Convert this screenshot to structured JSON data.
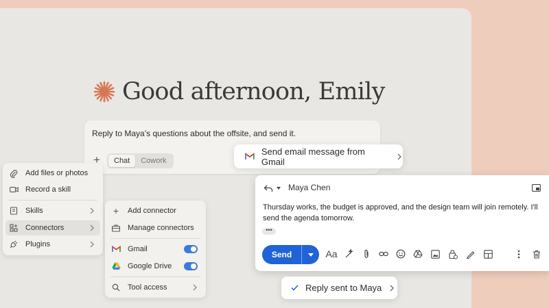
{
  "greeting": {
    "text": "Good afternoon, Emily"
  },
  "composer": {
    "prompt": "Reply to Maya’s questions about the offsite, and send it.",
    "modes": [
      "Chat",
      "Cowork"
    ],
    "active_mode": "Chat"
  },
  "attach_menu": {
    "items": [
      {
        "label": "Add files or photos",
        "icon": "paperclip-icon"
      },
      {
        "label": "Record a skill",
        "icon": "video-icon"
      },
      {
        "label": "Skills",
        "icon": "book-icon"
      },
      {
        "label": "Connectors",
        "icon": "connectors-icon",
        "selected": true
      },
      {
        "label": "Plugins",
        "icon": "plug-icon"
      }
    ]
  },
  "connectors_menu": {
    "add": "Add connector",
    "manage": "Manage connectors",
    "connectors": [
      {
        "label": "Gmail",
        "enabled": true
      },
      {
        "label": "Google Drive",
        "enabled": true
      }
    ],
    "tool_access": "Tool access"
  },
  "action_pill": {
    "label": "Send email message from Gmail"
  },
  "email": {
    "recipient": "Maya Chen",
    "body": "Thursday works, the budget is approved, and the design team will join remotely. I'll send the agenda tomorrow.",
    "more": "•••",
    "send_label": "Send",
    "toolbar_icons": [
      "formatting-icon",
      "ai-pen-icon",
      "attach-icon",
      "link-icon",
      "emoji-icon",
      "drive-icon",
      "photo-icon",
      "lock-clock-icon",
      "signature-icon",
      "layout-icon",
      "more-options-icon",
      "trash-icon"
    ]
  },
  "status_pill": {
    "label": "Reply sent to Maya"
  },
  "colors": {
    "accent": "#1f63d6",
    "toggle": "#3c7bd8",
    "spark": "#d77655",
    "backdrop": "#efcdbd",
    "app_bg": "#e9e7e3"
  }
}
